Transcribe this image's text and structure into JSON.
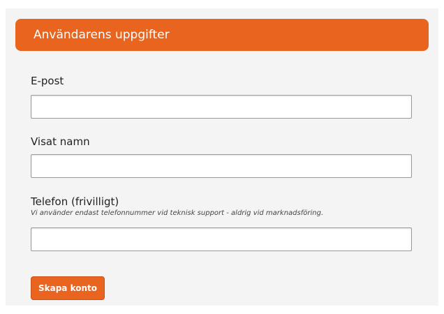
{
  "form": {
    "header": "Användarens uppgifter",
    "fields": [
      {
        "label": "E-post",
        "value": "",
        "placeholder": ""
      },
      {
        "label": "Visat namn",
        "value": "",
        "placeholder": ""
      },
      {
        "label": "Telefon (frivilligt)",
        "hint": "Vi använder endast telefonnummer vid teknisk support - aldrig vid marknadsföring.",
        "value": "",
        "placeholder": ""
      }
    ],
    "submit_label": "Skapa konto"
  },
  "colors": {
    "accent": "#e8641f",
    "panel_bg": "#f4f4f4"
  }
}
